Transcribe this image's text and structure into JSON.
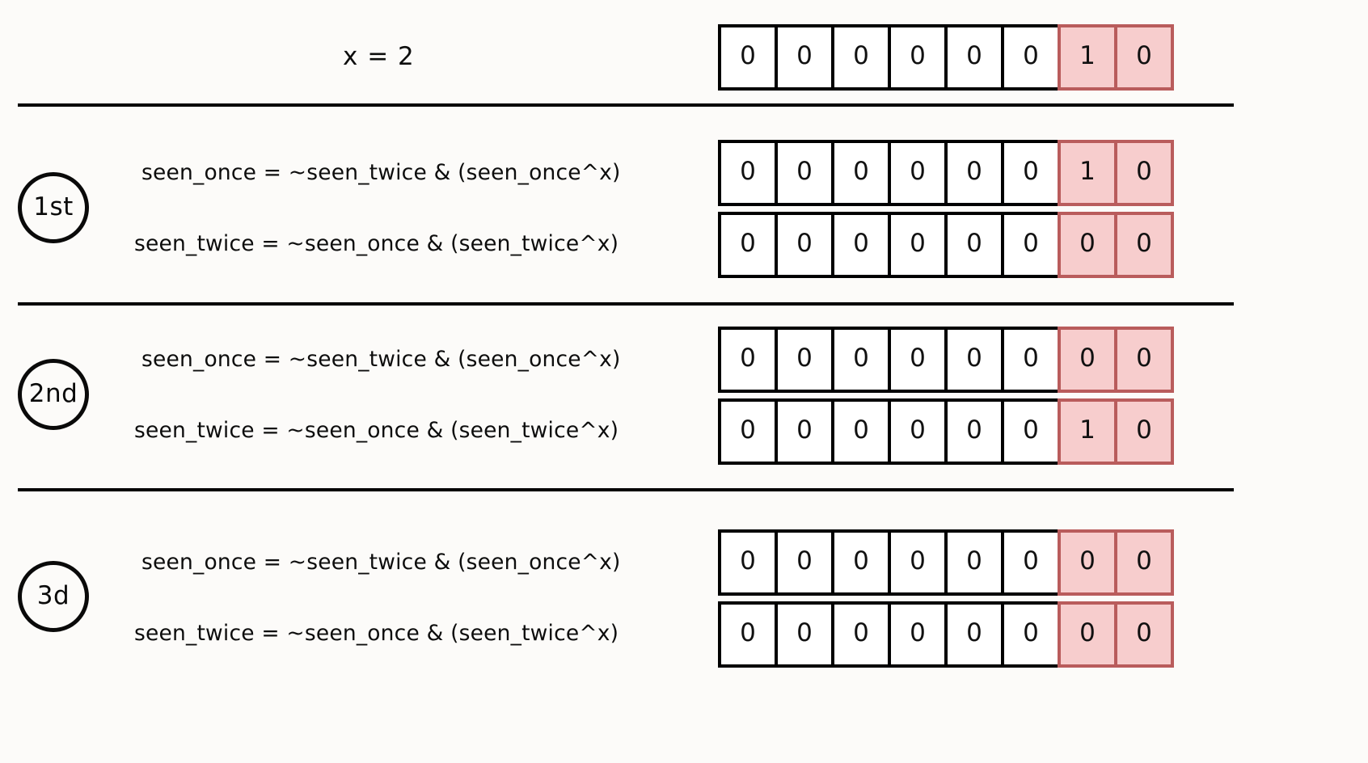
{
  "meta": {
    "title": "Bitwise single-number-III seen_once / seen_twice trace",
    "bit_width": 8,
    "highlighted_bit_count": 2
  },
  "colors": {
    "background": "#fcfbf9",
    "cell_border": "#000000",
    "cell_fill": "#ffffff",
    "highlight_fill": "#f7cdcd",
    "highlight_border": "#b95c5c",
    "text": "#0d0d0d",
    "divider": "#000000"
  },
  "header": {
    "label": "x = 2",
    "bits": [
      "0",
      "0",
      "0",
      "0",
      "0",
      "0",
      "1",
      "0"
    ],
    "highlight_from_index": 6
  },
  "formulas": {
    "seen_once": "seen_once = ~seen_twice & (seen_once^x)",
    "seen_twice": "seen_twice = ~seen_once & (seen_twice^x)"
  },
  "steps": [
    {
      "badge": "1st",
      "rows": [
        {
          "name": "seen_once",
          "formula": "seen_once = ~seen_twice & (seen_once^x)",
          "bits": [
            "0",
            "0",
            "0",
            "0",
            "0",
            "0",
            "1",
            "0"
          ],
          "highlight_from_index": 6
        },
        {
          "name": "seen_twice",
          "formula": "seen_twice = ~seen_once & (seen_twice^x)",
          "bits": [
            "0",
            "0",
            "0",
            "0",
            "0",
            "0",
            "0",
            "0"
          ],
          "highlight_from_index": 6
        }
      ]
    },
    {
      "badge": "2nd",
      "rows": [
        {
          "name": "seen_once",
          "formula": "seen_once = ~seen_twice & (seen_once^x)",
          "bits": [
            "0",
            "0",
            "0",
            "0",
            "0",
            "0",
            "0",
            "0"
          ],
          "highlight_from_index": 6
        },
        {
          "name": "seen_twice",
          "formula": "seen_twice = ~seen_once & (seen_twice^x)",
          "bits": [
            "0",
            "0",
            "0",
            "0",
            "0",
            "0",
            "1",
            "0"
          ],
          "highlight_from_index": 6
        }
      ]
    },
    {
      "badge": "3d",
      "rows": [
        {
          "name": "seen_once",
          "formula": "seen_once = ~seen_twice & (seen_once^x)",
          "bits": [
            "0",
            "0",
            "0",
            "0",
            "0",
            "0",
            "0",
            "0"
          ],
          "highlight_from_index": 6
        },
        {
          "name": "seen_twice",
          "formula": "seen_twice = ~seen_once & (seen_twice^x)",
          "bits": [
            "0",
            "0",
            "0",
            "0",
            "0",
            "0",
            "0",
            "0"
          ],
          "highlight_from_index": 6
        }
      ]
    }
  ]
}
